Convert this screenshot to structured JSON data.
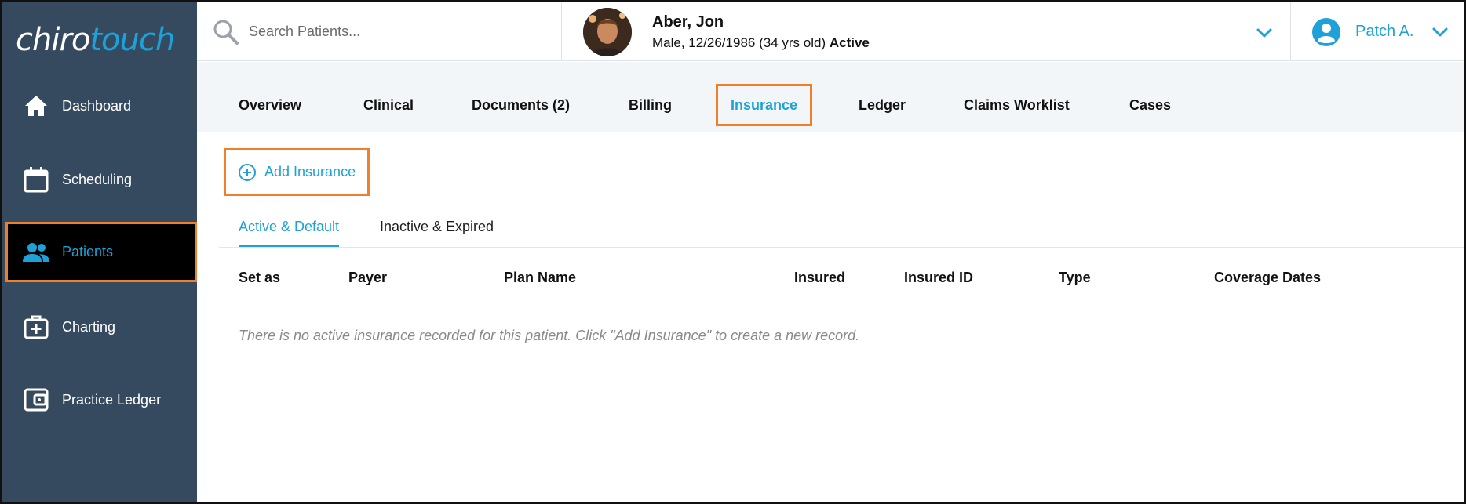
{
  "app": {
    "logo_part1": "chiro",
    "logo_part2": "touch"
  },
  "sidebar": {
    "items": [
      {
        "label": "Dashboard",
        "icon": "home-icon"
      },
      {
        "label": "Scheduling",
        "icon": "calendar-icon"
      },
      {
        "label": "Patients",
        "icon": "people-icon",
        "active": true
      },
      {
        "label": "Charting",
        "icon": "medical-bag-icon"
      },
      {
        "label": "Practice Ledger",
        "icon": "wallet-icon"
      }
    ]
  },
  "search": {
    "placeholder": "Search Patients..."
  },
  "patient": {
    "name": "Aber, Jon",
    "info": "Male, 12/26/1986 (34 yrs old)",
    "status": "Active"
  },
  "user": {
    "name": "Patch A."
  },
  "tabs": [
    {
      "label": "Overview"
    },
    {
      "label": "Clinical"
    },
    {
      "label": "Documents (2)"
    },
    {
      "label": "Billing"
    },
    {
      "label": "Insurance",
      "active": true
    },
    {
      "label": "Ledger"
    },
    {
      "label": "Claims Worklist"
    },
    {
      "label": "Cases"
    }
  ],
  "insurance": {
    "add_label": "Add Insurance",
    "subtabs": [
      {
        "label": "Active & Default",
        "active": true
      },
      {
        "label": "Inactive & Expired"
      }
    ],
    "columns": [
      "Set as",
      "Payer",
      "Plan Name",
      "Insured",
      "Insured ID",
      "Type",
      "Coverage Dates"
    ],
    "empty_message": "There is no active insurance recorded for this patient. Click \"Add Insurance\" to create a new record."
  },
  "colors": {
    "accent": "#1ea1d8",
    "highlight": "#f07f2a",
    "sidebar": "#364a5f"
  }
}
